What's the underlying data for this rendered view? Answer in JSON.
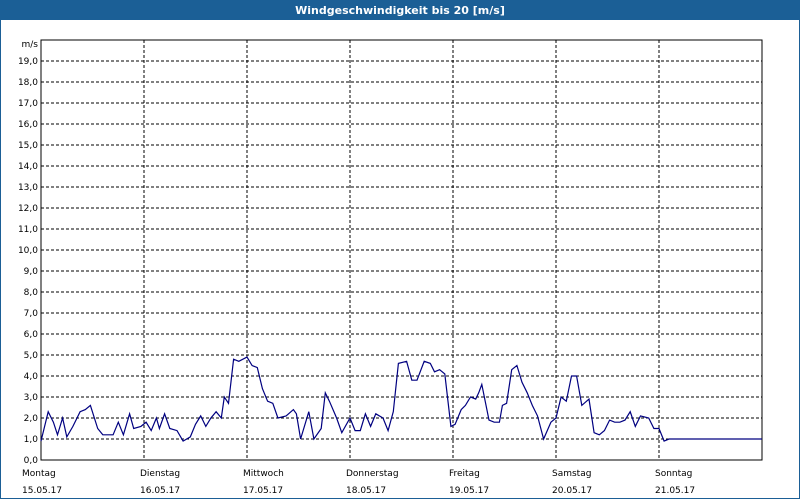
{
  "header": {
    "title": "Windgeschwindigkeit bis 20 [m/s]"
  },
  "colors": {
    "title_bg": "#1b5f96",
    "series": "#000080",
    "grid": "#000000"
  },
  "chart_data": {
    "type": "line",
    "title": "Windgeschwindigkeit bis 20 [m/s]",
    "ylabel": "m/s",
    "ylim": [
      0,
      20
    ],
    "grid": true,
    "yticks": [
      "0,0",
      "1,0",
      "2,0",
      "3,0",
      "4,0",
      "5,0",
      "6,0",
      "7,0",
      "8,0",
      "9,0",
      "10,0",
      "11,0",
      "12,0",
      "13,0",
      "14,0",
      "15,0",
      "16,0",
      "17,0",
      "18,0",
      "19,0"
    ],
    "x_range": [
      0,
      7
    ],
    "x_ticks": [
      {
        "day": "Montag",
        "date": "15.05.17"
      },
      {
        "day": "Dienstag",
        "date": "16.05.17"
      },
      {
        "day": "Mittwoch",
        "date": "17.05.17"
      },
      {
        "day": "Donnerstag",
        "date": "18.05.17"
      },
      {
        "day": "Freitag",
        "date": "19.05.17"
      },
      {
        "day": "Samstag",
        "date": "20.05.17"
      },
      {
        "day": "Sonntag",
        "date": "21.05.17"
      }
    ],
    "series": [
      {
        "x": [
          0.0,
          0.07,
          0.12,
          0.16,
          0.21,
          0.25,
          0.31,
          0.38,
          0.43,
          0.48,
          0.55,
          0.6,
          0.7,
          0.75,
          0.8,
          0.86,
          0.9,
          0.97,
          1.02,
          1.07,
          1.12,
          1.15,
          1.2,
          1.25,
          1.32,
          1.38,
          1.45,
          1.5,
          1.55,
          1.6,
          1.65,
          1.7,
          1.75,
          1.78,
          1.82,
          1.87,
          1.92,
          2.0,
          2.05,
          2.1,
          2.15,
          2.2,
          2.25,
          2.3,
          2.38,
          2.45,
          2.48,
          2.52,
          2.6,
          2.65,
          2.72,
          2.76,
          2.8,
          2.87,
          2.92,
          3.0,
          3.05,
          3.1,
          3.15,
          3.2,
          3.25,
          3.32,
          3.37,
          3.42,
          3.47,
          3.55,
          3.6,
          3.65,
          3.72,
          3.78,
          3.82,
          3.87,
          3.92,
          3.98,
          4.02,
          4.08,
          4.12,
          4.17,
          4.22,
          4.25,
          4.28,
          4.35,
          4.4,
          4.45,
          4.48,
          4.52,
          4.57,
          4.62,
          4.67,
          4.72,
          4.77,
          4.82,
          4.88,
          4.95,
          5.0,
          5.05,
          5.1,
          5.15,
          5.2,
          5.25,
          5.32,
          5.37,
          5.42,
          5.47,
          5.52,
          5.57,
          5.62,
          5.67,
          5.72,
          5.77,
          5.82,
          5.9,
          5.95,
          6.0,
          6.05,
          6.1,
          6.15,
          6.2,
          6.23,
          6.27,
          6.3,
          6.35,
          6.4,
          6.45,
          6.52,
          6.57,
          6.62,
          6.67,
          6.72,
          6.77,
          6.82,
          6.87,
          6.92,
          6.97,
          7.0
        ],
        "values": [
          0.9,
          2.3,
          1.8,
          1.2,
          2.0,
          1.1,
          1.6,
          2.3,
          2.4,
          2.6,
          1.5,
          1.2,
          1.2,
          1.8,
          1.2,
          2.2,
          1.5,
          1.6,
          1.8,
          1.4,
          2.0,
          1.5,
          2.2,
          1.5,
          1.4,
          0.9,
          1.1,
          1.7,
          2.1,
          1.6,
          2.0,
          2.3,
          2.0,
          3.0,
          2.7,
          4.8,
          4.7,
          4.9,
          4.5,
          4.4,
          3.4,
          2.8,
          2.7,
          2.0,
          2.1,
          2.4,
          2.2,
          1.0,
          2.3,
          1.0,
          1.5,
          3.2,
          2.8,
          2.0,
          1.3,
          2.0,
          1.4,
          1.4,
          2.2,
          1.6,
          2.2,
          2.0,
          1.4,
          2.3,
          4.6,
          4.7,
          3.8,
          3.8,
          4.7,
          4.6,
          4.2,
          4.3,
          4.1,
          1.6,
          1.7,
          2.4,
          2.6,
          3.0,
          2.9,
          3.2,
          3.6,
          1.9,
          1.8,
          1.8,
          2.6,
          2.7,
          4.3,
          4.5,
          3.7,
          3.2,
          2.6,
          2.1,
          1.0,
          1.8,
          2.0,
          3.0,
          2.8,
          4.0,
          4.0,
          2.6,
          2.9,
          1.3,
          1.2,
          1.4,
          1.9,
          1.8,
          1.8,
          1.9,
          2.3,
          1.6,
          2.1,
          2.0,
          1.5,
          1.5,
          0.9,
          1.0,
          1.0,
          1.0,
          1.0,
          1.0,
          1.0,
          1.0,
          1.0,
          1.0,
          1.0,
          1.0,
          1.0,
          1.0,
          1.0,
          1.0,
          1.0,
          1.0,
          1.0,
          1.0,
          1.0
        ]
      }
    ]
  }
}
